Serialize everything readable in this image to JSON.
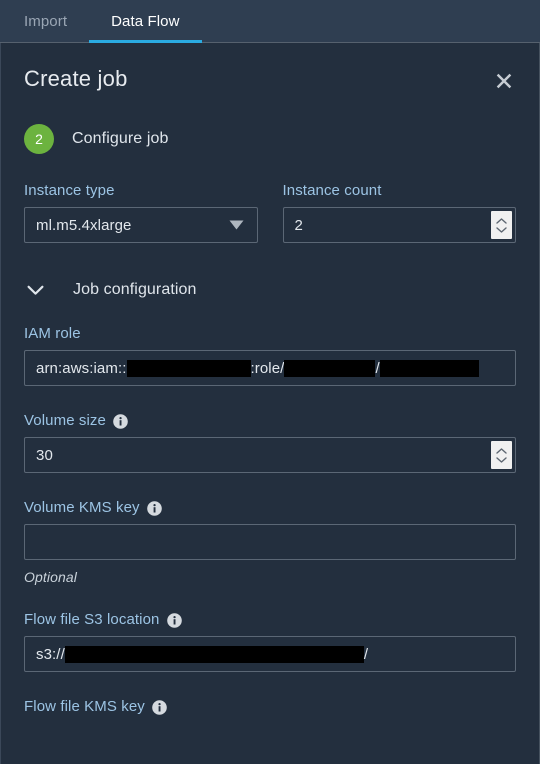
{
  "tabs": [
    {
      "label": "Import",
      "active": false
    },
    {
      "label": "Data Flow",
      "active": true
    }
  ],
  "panel": {
    "title": "Create job",
    "close_icon": "close-icon"
  },
  "step": {
    "number": "2",
    "title": "Configure job",
    "badge_color": "#6cb33f"
  },
  "form": {
    "instance_type": {
      "label": "Instance type",
      "value": "ml.m5.4xlarge",
      "icon": "chevron-down-icon"
    },
    "instance_count": {
      "label": "Instance count",
      "value": "2",
      "icon": "stepper-icon"
    },
    "job_configuration": {
      "label": "Job configuration",
      "icon": "chevron-down-icon",
      "expanded": true
    },
    "iam_role": {
      "label": "IAM role",
      "prefix": "arn:aws:iam::",
      "middle": ":role/",
      "separator": "/"
    },
    "volume_size": {
      "label": "Volume size",
      "value": "30",
      "info_icon": "info-icon"
    },
    "volume_kms_key": {
      "label": "Volume KMS key",
      "value": "",
      "info_icon": "info-icon",
      "hint": "Optional"
    },
    "flow_file_s3_location": {
      "label": "Flow file S3 location",
      "prefix": "s3://",
      "suffix": "/",
      "info_icon": "info-icon"
    },
    "flow_file_kms_key": {
      "label": "Flow file KMS key",
      "info_icon": "info-icon"
    }
  },
  "colors": {
    "accent": "#2aabe2",
    "panel_bg": "#232f3e",
    "tabbar_bg": "#2f3e51",
    "label": "#9cc4e4",
    "step_green": "#6cb33f"
  }
}
